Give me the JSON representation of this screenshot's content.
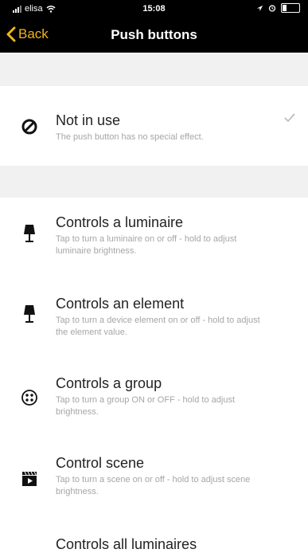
{
  "status_bar": {
    "carrier": "elisa",
    "time": "15:08"
  },
  "nav": {
    "back_label": "Back",
    "title": "Push buttons"
  },
  "options": [
    {
      "title": "Not in use",
      "description": "The push button has no special effect.",
      "icon": "prohibited-icon",
      "selected": true
    },
    {
      "title": "Controls a luminaire",
      "description": "Tap to turn a luminaire on or off - hold to adjust luminaire brightness.",
      "icon": "lamp-icon"
    },
    {
      "title": "Controls an element",
      "description": "Tap to turn a device element on or off - hold to adjust the element value.",
      "icon": "lamp-icon"
    },
    {
      "title": "Controls a group",
      "description": "Tap to turn a group ON or OFF - hold to adjust brightness.",
      "icon": "group-icon"
    },
    {
      "title": "Control scene",
      "description": "Tap to turn a scene on or off - hold to adjust scene brightness.",
      "icon": "scene-clapper-icon"
    },
    {
      "title": "Controls all luminaires"
    }
  ]
}
